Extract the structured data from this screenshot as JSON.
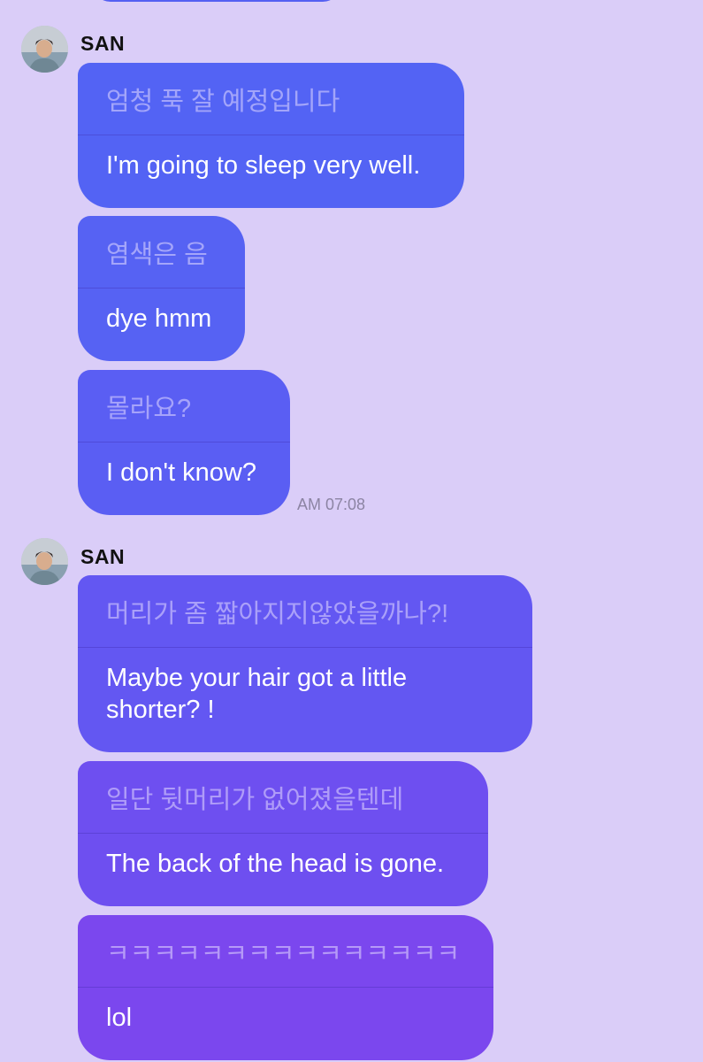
{
  "groups": [
    {
      "sender": "SAN",
      "messages": [
        {
          "original": "엄청 푹 잘 예정입니다",
          "translation": "I'm going to sleep very well."
        },
        {
          "original": "염색은 음",
          "translation": "dye hmm"
        },
        {
          "original": "몰라요?",
          "translation": "I don't know?"
        }
      ],
      "time": "AM 07:08"
    },
    {
      "sender": "SAN",
      "messages": [
        {
          "original": "머리가 좀 짧아지지않았을까나?!",
          "translation": "Maybe your hair got a little shorter? !"
        },
        {
          "original": "일단 뒷머리가 없어졌을텐데",
          "translation": "The back of the head is gone."
        },
        {
          "original": "ㅋㅋㅋㅋㅋㅋㅋㅋㅋㅋㅋㅋㅋㅋㅋ",
          "translation": "lol"
        }
      ]
    }
  ],
  "colors": {
    "background": "#dacdf8",
    "bubble_gradient_start": "#5363f4",
    "bubble_gradient_end": "#7c47ee",
    "timestamp": "#8c84a3"
  },
  "icons": {
    "avatar": "user-photo-avatar"
  }
}
